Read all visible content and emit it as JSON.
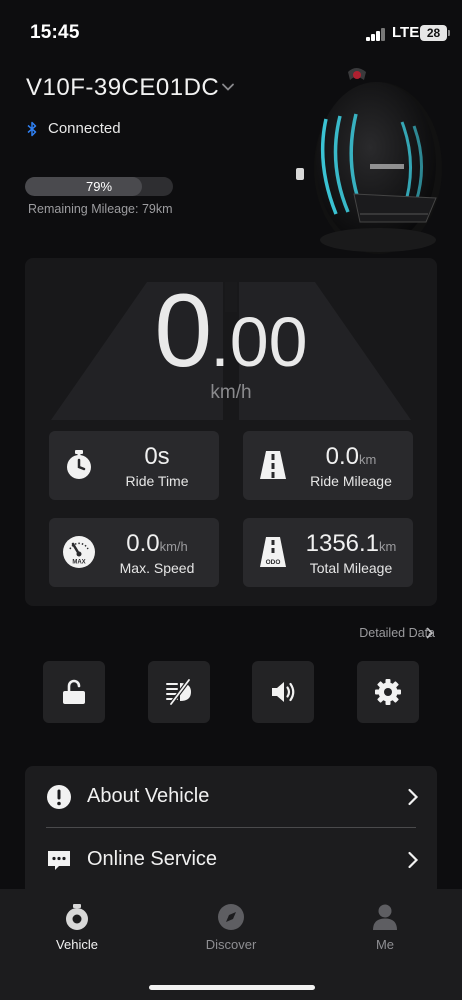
{
  "status_bar": {
    "time": "15:45",
    "network": "LTE",
    "battery": "28"
  },
  "header": {
    "vehicle_name": "V10F-39CE01DC",
    "connection_status": "Connected"
  },
  "battery": {
    "percent_label": "79%",
    "level": 0.79,
    "remaining_mileage": "Remaining Mileage: 79km"
  },
  "speed": {
    "integer": "0",
    "dot": ".",
    "decimal": "00",
    "unit": "km/h"
  },
  "stats": {
    "ride_time": {
      "value": "0s",
      "unit": "",
      "label": "Ride Time"
    },
    "ride_mileage": {
      "value": "0.0",
      "unit": "km",
      "label": "Ride Mileage"
    },
    "max_speed": {
      "value": "0.0",
      "unit": "km/h",
      "label": "Max. Speed",
      "icon_text": "MAX"
    },
    "total_mileage": {
      "value": "1356.1",
      "unit": "km",
      "label": "Total Mileage",
      "icon_text": "ODO"
    }
  },
  "detailed_data": {
    "label": "Detailed Data"
  },
  "quick_actions": [
    {
      "icon": "unlock-icon"
    },
    {
      "icon": "light-off-icon"
    },
    {
      "icon": "speaker-icon"
    },
    {
      "icon": "gear-icon"
    }
  ],
  "menu": [
    {
      "label": "About Vehicle",
      "icon": "info-icon"
    },
    {
      "label": "Online Service",
      "icon": "chat-icon"
    }
  ],
  "tabs": [
    {
      "label": "Vehicle",
      "icon": "vehicle-icon",
      "active": true
    },
    {
      "label": "Discover",
      "icon": "compass-icon",
      "active": false
    },
    {
      "label": "Me",
      "icon": "person-icon",
      "active": false
    }
  ],
  "colors": {
    "background": "#0d0d0f",
    "card": "#18181a",
    "tile": "#29292c",
    "bluetooth": "#2f7ff0",
    "accent_cyan": "#3fd6e8"
  }
}
